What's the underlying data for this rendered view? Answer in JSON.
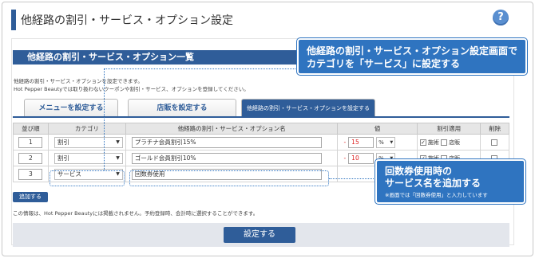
{
  "page": {
    "title": "他経路の割引・サービス・オプション設定",
    "help_icon": "?"
  },
  "section": {
    "header": "他経路の割引・サービス・オプション一覧",
    "desc1": "他経路の割引・サービス・オプションを設定できます。",
    "desc2": "Hot Pepper Beautyでは取り扱わないクーポンや割引・サービス、オプションを登録してください。"
  },
  "tabs": [
    {
      "label": "メニューを設定する"
    },
    {
      "label": "店販を設定する"
    },
    {
      "label": "他経路の割引・サービス・オプションを設定する"
    }
  ],
  "table": {
    "headers": [
      "並び順",
      "カテゴリ",
      "他経路の割引・サービス・オプション名",
      "値",
      "割引適用",
      "削除"
    ],
    "rows": [
      {
        "order": "1",
        "category": "割引",
        "name": "プラチナ会員割引15%",
        "value": "15",
        "unit": "%",
        "apply1": "施術",
        "apply2": "店販",
        "apply1_checked": true,
        "apply2_checked": false
      },
      {
        "order": "2",
        "category": "割引",
        "name": "ゴールド会員割引10%",
        "value": "10",
        "unit": "%",
        "apply1": "施術",
        "apply2": "店販",
        "apply1_checked": true,
        "apply2_checked": false
      },
      {
        "order": "3",
        "category": "サービス",
        "name": "回数券使用",
        "value": "",
        "unit": "",
        "apply1": "",
        "apply2": "",
        "apply1_checked": false,
        "apply2_checked": false
      }
    ],
    "value_prefix": "-",
    "dropdown_arrow": "▼"
  },
  "add_button": "追加する",
  "note": "この情報は、Hot Pepper Beautyには掲載されません。予約登録時、会計時に選択することができます。",
  "submit_button": "設定する",
  "callouts": {
    "c1_line1": "他経路の割引・サービス・オプション設定画面で",
    "c1_line2": "カテゴリを「サービス」に設定する",
    "c2_line1": "回数券使用時の",
    "c2_line2": "サービス名を追加する",
    "c2_small": "※画面では「回数券使用」と入力しています"
  },
  "colors": {
    "accent": "#2f5d99",
    "callout": "#2f74c0",
    "value_red": "#d22222"
  }
}
